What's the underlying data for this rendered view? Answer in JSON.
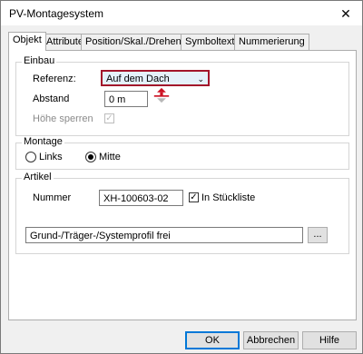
{
  "window": {
    "title": "PV-Montagesystem",
    "close_label": "✕"
  },
  "tabs": [
    {
      "label": "Objekt"
    },
    {
      "label": "Attribute"
    },
    {
      "label": "Position/Skal./Drehen"
    },
    {
      "label": "Symboltext"
    },
    {
      "label": "Nummerierung"
    }
  ],
  "einbau": {
    "group_label": "Einbau",
    "referenz_label": "Referenz:",
    "referenz_value": "Auf dem Dach",
    "abstand_label": "Abstand",
    "abstand_value": "0 m",
    "hoehe_label": "Höhe sperren",
    "hoehe_checked": true
  },
  "montage": {
    "group_label": "Montage",
    "options": [
      {
        "label": "Links",
        "selected": false
      },
      {
        "label": "Mitte",
        "selected": true
      }
    ]
  },
  "artikel": {
    "group_label": "Artikel",
    "nummer_label": "Nummer",
    "nummer_value": "XH-100603-02",
    "stueckliste_label": "In Stückliste",
    "stueckliste_checked": true,
    "profil_value": "Grund-/Träger-/Systemprofil frei",
    "browse_label": "..."
  },
  "buttons": {
    "ok": "OK",
    "cancel": "Abbrechen",
    "help": "Hilfe"
  },
  "colors": {
    "highlight": "#a3152b",
    "arrow": "#cc1122"
  }
}
